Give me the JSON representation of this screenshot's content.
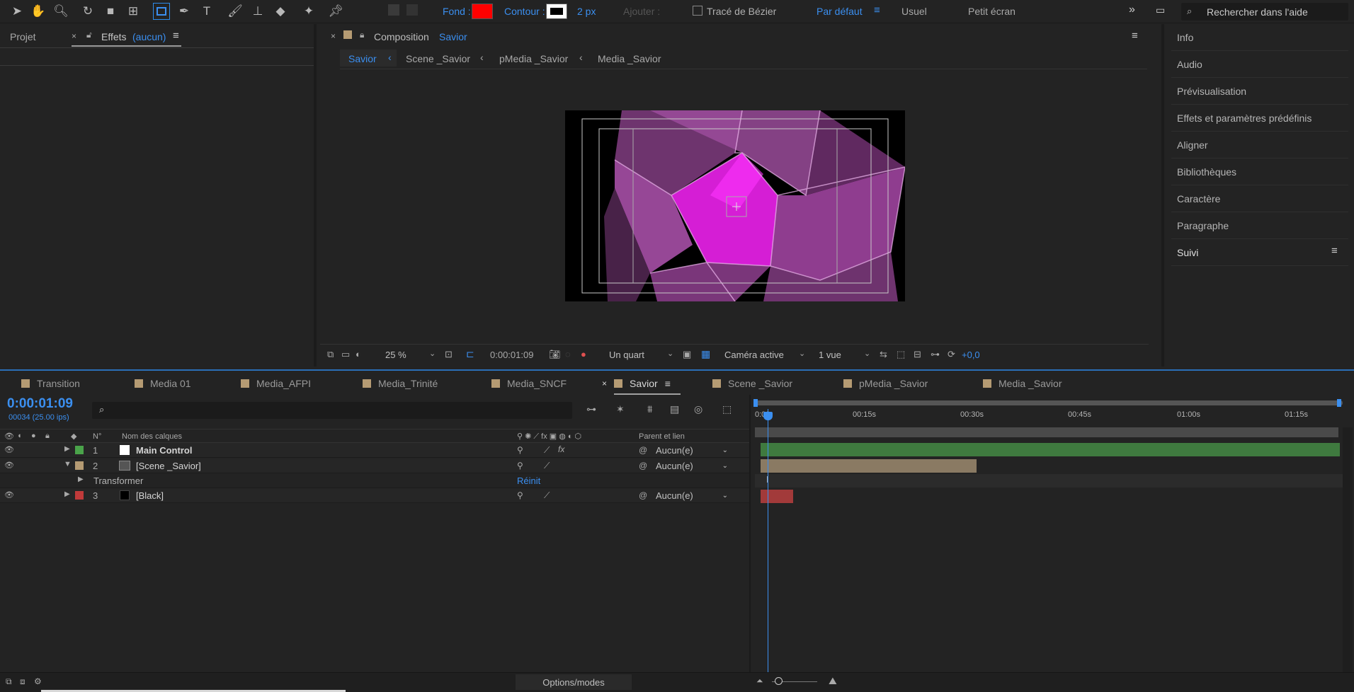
{
  "toolbar": {
    "fill_label": "Fond :",
    "fill_color": "#ff0000",
    "stroke_label": "Contour :",
    "stroke_width": "2 px",
    "add_label": "Ajouter :",
    "bezier_label": "Tracé de Bézier",
    "workspace_default": "Par défaut",
    "workspace_usual": "Usuel",
    "workspace_small": "Petit écran",
    "search_placeholder": "Rechercher dans l'aide"
  },
  "left_panel": {
    "tab_project": "Projet",
    "tab_effects": "Effets",
    "tab_effects_sub": "(aucun)"
  },
  "composition": {
    "header_label": "Composition",
    "header_name": "Savior",
    "breadcrumbs": [
      "Savior",
      "Scene _Savior",
      "pMedia _Savior",
      "Media _Savior"
    ],
    "zoom": "25 %",
    "timecode": "0:00:01:09",
    "resolution": "Un quart",
    "camera": "Caméra active",
    "views": "1 vue",
    "exposure": "+0,0"
  },
  "right_panel": {
    "items": [
      "Info",
      "Audio",
      "Prévisualisation",
      "Effets et paramètres prédéfinis",
      "Aligner",
      "Bibliothèques",
      "Caractère",
      "Paragraphe",
      "Suivi"
    ]
  },
  "timeline": {
    "tabs": [
      "Transition",
      "Media 01",
      "Media_AFPI",
      "Media_Trinité",
      "Media_SNCF",
      "Savior",
      "Scene _Savior",
      "pMedia _Savior",
      "Media _Savior"
    ],
    "timecode": "0:00:01:09",
    "frames": "00034 (25.00 ips)",
    "col_number": "N°",
    "col_layer_name": "Nom des calques",
    "col_parent": "Parent et lien",
    "ruler": [
      "0:00",
      "00:15s",
      "00:30s",
      "00:45s",
      "01:00s",
      "01:15s"
    ],
    "layers": [
      {
        "num": "1",
        "name": "Main Control",
        "parent": "Aucun(e)",
        "label_color": "#4aa34a",
        "swatch": "#ffffff"
      },
      {
        "num": "2",
        "name": "[Scene _Savior]",
        "parent": "Aucun(e)",
        "label_color": "#b59b73",
        "swatch": "#777777"
      },
      {
        "num": "3",
        "name": "[Black]",
        "parent": "Aucun(e)",
        "label_color": "#c03a3a",
        "swatch": "#000000"
      }
    ],
    "transform_label": "Transformer",
    "reset_label": "Réinit",
    "options_modes": "Options/modes"
  }
}
